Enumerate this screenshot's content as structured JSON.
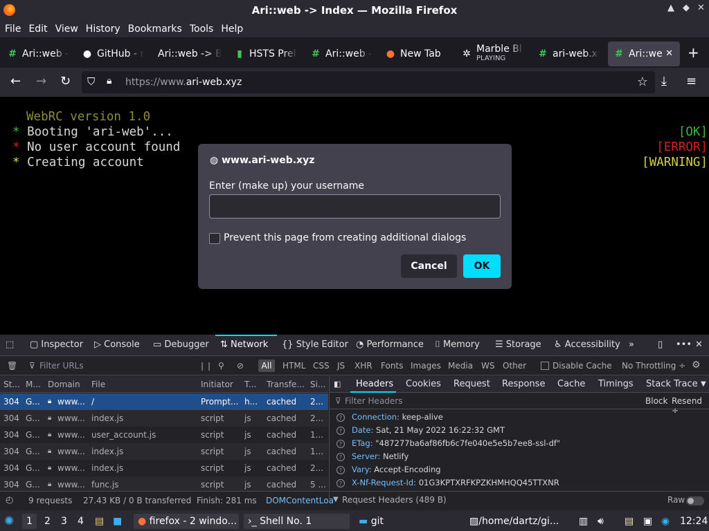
{
  "window": {
    "title": "Ari::web -> Index — Mozilla Firefox"
  },
  "menu": [
    "File",
    "Edit",
    "View",
    "History",
    "Bookmarks",
    "Tools",
    "Help"
  ],
  "tabs": [
    {
      "label": "Ari::web -",
      "icon": "hash-icon"
    },
    {
      "label": "GitHub - n",
      "icon": "github-icon"
    },
    {
      "label": "Ari::web -> B",
      "icon": "none"
    },
    {
      "label": "HSTS Prel",
      "icon": "lock-icon"
    },
    {
      "label": "Ari::web -",
      "icon": "hash-icon"
    },
    {
      "label": "New Tab",
      "icon": "firefox-icon"
    },
    {
      "label": "Marble Bl",
      "sublabel": "PLAYING",
      "icon": "marble-icon"
    },
    {
      "label": "ari-web.xy",
      "icon": "hash-icon"
    },
    {
      "label": "Ari::we",
      "icon": "hash-icon",
      "active": true
    }
  ],
  "nav": {
    "url_prefix": "https://www.",
    "url_domain": "ari-web.xyz"
  },
  "terminal": {
    "header": "WebRC version 1.0",
    "lines": [
      {
        "bullet": "*",
        "text": "Booting 'ari-web'...",
        "status": "[OK]"
      },
      {
        "bullet": "*",
        "text": "No user account found",
        "status": "[ERROR]"
      },
      {
        "bullet": "*",
        "text": "Creating account",
        "status": "[WARNING]"
      }
    ]
  },
  "dialog": {
    "host": "www.ari-web.xyz",
    "prompt": "Enter (make up) your username",
    "input_value": "",
    "checkbox_label": "Prevent this page from creating additional dialogs",
    "cancel": "Cancel",
    "ok": "OK"
  },
  "devtools": {
    "tabs": [
      "Inspector",
      "Console",
      "Debugger",
      "Network",
      "Style Editor",
      "Performance",
      "Memory",
      "Storage",
      "Accessibility"
    ],
    "selected_tab": "Network",
    "filter_placeholder": "Filter URLs",
    "filters": [
      "All",
      "HTML",
      "CSS",
      "JS",
      "XHR",
      "Fonts",
      "Images",
      "Media",
      "WS",
      "Other"
    ],
    "disable_cache": "Disable Cache",
    "throttling": "No Throttling ÷",
    "columns": [
      "St...",
      "M...",
      "Domain",
      "File",
      "Initiator",
      "T...",
      "Transfe...",
      "Si..."
    ],
    "requests": [
      {
        "status": "304",
        "method": "G...",
        "domain": "www...",
        "file": "/",
        "initiator": "Prompt...",
        "type": "h...",
        "transferred": "cached",
        "size": "2..."
      },
      {
        "status": "304",
        "method": "G...",
        "domain": "www...",
        "file": "index.js",
        "initiator": "script",
        "type": "js",
        "transferred": "cached",
        "size": "2..."
      },
      {
        "status": "304",
        "method": "G...",
        "domain": "www...",
        "file": "user_account.js",
        "initiator": "script",
        "type": "js",
        "transferred": "cached",
        "size": "1..."
      },
      {
        "status": "304",
        "method": "G...",
        "domain": "www...",
        "file": "index.js",
        "initiator": "script",
        "type": "js",
        "transferred": "cached",
        "size": "1..."
      },
      {
        "status": "304",
        "method": "G...",
        "domain": "www...",
        "file": "index.js",
        "initiator": "script",
        "type": "js",
        "transferred": "cached",
        "size": "2..."
      },
      {
        "status": "304",
        "method": "G...",
        "domain": "www...",
        "file": "func.js",
        "initiator": "script",
        "type": "js",
        "transferred": "cached",
        "size": "5 ..."
      }
    ],
    "detail_tabs": [
      "Headers",
      "Cookies",
      "Request",
      "Response",
      "Cache",
      "Timings",
      "Stack Trace"
    ],
    "filter_headers": "Filter Headers",
    "block": "Block",
    "resend": "Resend ÷",
    "headers": [
      {
        "k": "Connection:",
        "v": "keep-alive"
      },
      {
        "k": "Date:",
        "v": "Sat, 21 May 2022 16:22:32 GMT"
      },
      {
        "k": "ETag:",
        "v": "\"487277ba6af86fb6c7fe040e5e5b7ee8-ssl-df\""
      },
      {
        "k": "Server:",
        "v": "Netlify"
      },
      {
        "k": "Vary:",
        "v": "Accept-Encoding"
      },
      {
        "k": "X-Nf-Request-Id:",
        "v": "01G3KPTXRFKPZKHMHQQ45TTXNR"
      }
    ],
    "status": {
      "requests": "9 requests",
      "transferred": "27.43 KB / 0 B transferred",
      "finish": "Finish: 281 ms",
      "dom": "DOMContentLoa"
    },
    "request_headers": "Request Headers (489 B)",
    "raw": "Raw"
  },
  "taskbar": {
    "workspaces": [
      "1",
      "2",
      "3",
      "4"
    ],
    "apps": [
      "firefox - 2 windo...",
      "Shell No. 1",
      "git",
      "/home/dartz/gi..."
    ],
    "clock": "12:24"
  }
}
